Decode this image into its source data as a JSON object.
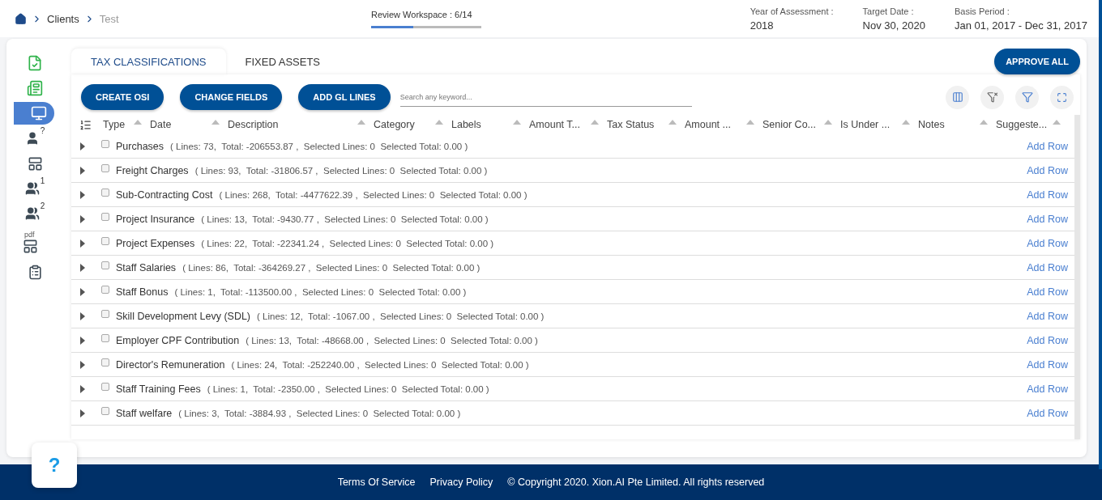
{
  "breadcrumb": [
    "Clients",
    "Test"
  ],
  "progress": {
    "label": "Review Workspace : 6/14",
    "level": 0.38
  },
  "info": [
    {
      "label": "Year of Assessment :",
      "value": "2018"
    },
    {
      "label": "Target Date :",
      "value": "Nov 30, 2020"
    },
    {
      "label": "Basis Period :",
      "value": "Jan 01, 2017 - Dec 31, 2017"
    }
  ],
  "sidebar": [
    {
      "kind": "file-check",
      "selected": false
    },
    {
      "kind": "ledger",
      "selected": false
    },
    {
      "kind": "monitor",
      "selected": true
    },
    {
      "kind": "user-question",
      "badge": "?",
      "selected": false
    },
    {
      "kind": "table",
      "selected": false
    },
    {
      "kind": "users",
      "badge": "1",
      "selected": false
    },
    {
      "kind": "users",
      "badge": "2",
      "selected": false
    },
    {
      "kind": "table",
      "badge": "pdf",
      "selected": false
    },
    {
      "kind": "clipboard",
      "selected": false
    }
  ],
  "tabs": [
    {
      "label": "TAX CLASSIFICATIONS",
      "selected": true
    },
    {
      "label": "FIXED ASSETS",
      "selected": false
    }
  ],
  "approve_button": "APPROVE ALL",
  "action_buttons": [
    "CREATE OSI",
    "CHANGE FIELDS",
    "ADD GL LINES"
  ],
  "search": {
    "placeholder": "Search any keyword..."
  },
  "columns": [
    "Type",
    "Date",
    "Description",
    "Category",
    "Labels",
    "Amount T...",
    "Tax Status",
    "Amount ...",
    "Senior Co...",
    "Is Under ...",
    "Notes",
    "Suggeste..."
  ],
  "rows": [
    {
      "name": "Purchases",
      "summary": "( Lines: 73,  Total: -206553.87 ,  Selected Lines: 0  Selected Total: 0.00 )",
      "action": "Add Row",
      "checked": false,
      "expanded": false
    },
    {
      "name": "Freight Charges",
      "summary": "( Lines: 93,  Total: -31806.57 ,  Selected Lines: 0  Selected Total: 0.00 )",
      "action": "Add Row",
      "checked": false,
      "expanded": false
    },
    {
      "name": "Sub-Contracting Cost",
      "summary": "( Lines: 268,  Total: -4477622.39 ,  Selected Lines: 0  Selected Total: 0.00 )",
      "action": "Add Row",
      "checked": false,
      "expanded": false
    },
    {
      "name": "Project Insurance",
      "summary": "( Lines: 13,  Total: -9430.77 ,  Selected Lines: 0  Selected Total: 0.00 )",
      "action": "Add Row",
      "checked": false,
      "expanded": false
    },
    {
      "name": "Project Expenses",
      "summary": "( Lines: 22,  Total: -22341.24 ,  Selected Lines: 0  Selected Total: 0.00 )",
      "action": "Add Row",
      "checked": false,
      "expanded": false
    },
    {
      "name": "Staff Salaries",
      "summary": "( Lines: 86,  Total: -364269.27 ,  Selected Lines: 0  Selected Total: 0.00 )",
      "action": "Add Row",
      "checked": false,
      "expanded": false
    },
    {
      "name": "Staff Bonus",
      "summary": "( Lines: 1,  Total: -113500.00 ,  Selected Lines: 0  Selected Total: 0.00 )",
      "action": "Add Row",
      "checked": false,
      "expanded": false
    },
    {
      "name": "Skill Development Levy (SDL)",
      "summary": "( Lines: 12,  Total: -1067.00 ,  Selected Lines: 0  Selected Total: 0.00 )",
      "action": "Add Row",
      "checked": false,
      "expanded": false
    },
    {
      "name": "Employer CPF Contribution",
      "summary": "( Lines: 13,  Total: -48668.00 ,  Selected Lines: 0  Selected Total: 0.00 )",
      "action": "Add Row",
      "checked": false,
      "expanded": false
    },
    {
      "name": "Director's Remuneration",
      "summary": "( Lines: 24,  Total: -252240.00 ,  Selected Lines: 0  Selected Total: 0.00 )",
      "action": "Add Row",
      "checked": false,
      "expanded": false
    },
    {
      "name": "Staff Training Fees",
      "summary": "( Lines: 1,  Total: -2350.00 ,  Selected Lines: 0  Selected Total: 0.00 )",
      "action": "Add Row",
      "checked": false,
      "expanded": false
    },
    {
      "name": "Staff welfare",
      "summary": "( Lines: 3,  Total: -3884.93 ,  Selected Lines: 0  Selected Total: 0.00 )",
      "action": "Add Row",
      "checked": false,
      "expanded": false
    }
  ],
  "help_button": "?",
  "footer": {
    "links": [
      "Terms Of Service",
      "Privacy Policy"
    ],
    "copyright": "© Copyright 2020. Xion.AI Pte Limited. All rights reserved"
  }
}
